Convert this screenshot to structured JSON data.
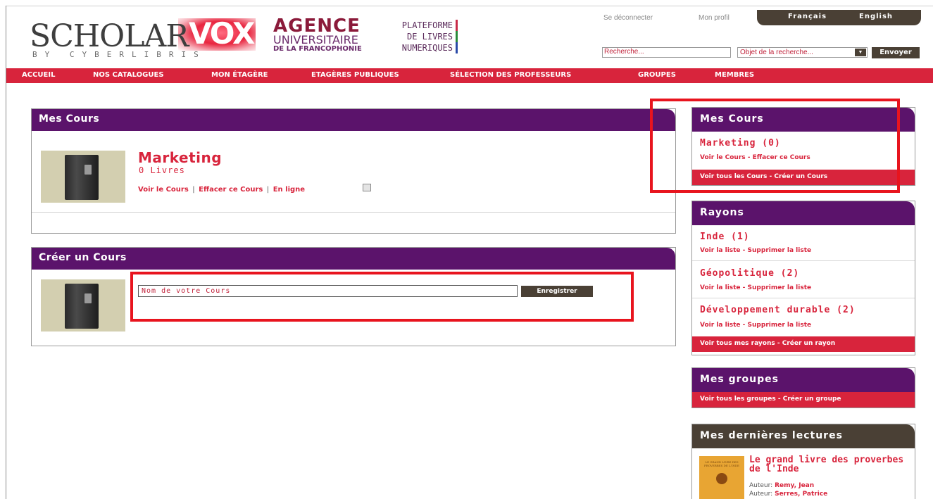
{
  "header": {
    "logo_main": "SCHOLAR",
    "logo_accent": "VOX",
    "logo_tagline": "BY CYBERLIBRIS",
    "agence_line1": "AGENCE",
    "agence_line2": "UNIVERSITAIRE",
    "agence_line3": "DE LA FRANCOPHONIE",
    "plateforme": [
      "PLATEFORME",
      "DE LIVRES",
      "NUMERIQUES"
    ],
    "logout": "Se déconnecter",
    "profile": "Mon profil",
    "lang_fr": "Français",
    "lang_en": "English",
    "search_placeholder": "Recherche...",
    "search_select": "Objet de la recherche...",
    "search_button": "Envoyer"
  },
  "nav": {
    "items": [
      "ACCUEIL",
      "NOS CATALOGUES",
      "MON ÉTAGÈRE",
      "ETAGÈRES PUBLIQUES",
      "SÉLECTION DES PROFESSEURS",
      "GROUPES",
      "MEMBRES"
    ]
  },
  "mes_cours": {
    "title": "Mes Cours",
    "course": {
      "name": "Marketing",
      "count": "0 Livres",
      "link_view": "Voir le Cours",
      "link_delete": "Effacer ce Cours",
      "link_online": "En ligne",
      "separator": "|"
    }
  },
  "creer_cours": {
    "title": "Créer un Cours",
    "input_value": "Nom de votre Cours",
    "button": "Enregistrer"
  },
  "sidebar": {
    "cours": {
      "title": "Mes Cours",
      "item_title": "Marketing (0)",
      "item_links": "Voir le Cours - Effacer ce Cours",
      "footer": "Voir tous les Cours - Créer un Cours"
    },
    "rayons": {
      "title": "Rayons",
      "items": [
        {
          "title": "Inde (1)",
          "links": "Voir la liste - Supprimer la liste"
        },
        {
          "title": "Géopolitique (2)",
          "links": "Voir la liste - Supprimer la liste"
        },
        {
          "title": "Développement durable (2)",
          "links": "Voir la liste - Supprimer la liste"
        }
      ],
      "footer": "Voir tous mes rayons - Créer un rayon"
    },
    "groupes": {
      "title": "Mes groupes",
      "footer": "Voir tous les groupes - Créer un groupe"
    },
    "lectures": {
      "title": "Mes dernières lectures",
      "book_title": "Le grand livre des proverbes de l'Inde",
      "cover_text": "LE GRAND LIVRE DES PROVERBES DE L'INDE",
      "author_label": "Auteur:",
      "authors": [
        "Remy, Jean",
        "Serres, Patrice"
      ]
    }
  },
  "colors": {
    "purple": "#5b136b",
    "red": "#d8243c",
    "brown": "#4a4035",
    "highlight": "#e8141e"
  }
}
